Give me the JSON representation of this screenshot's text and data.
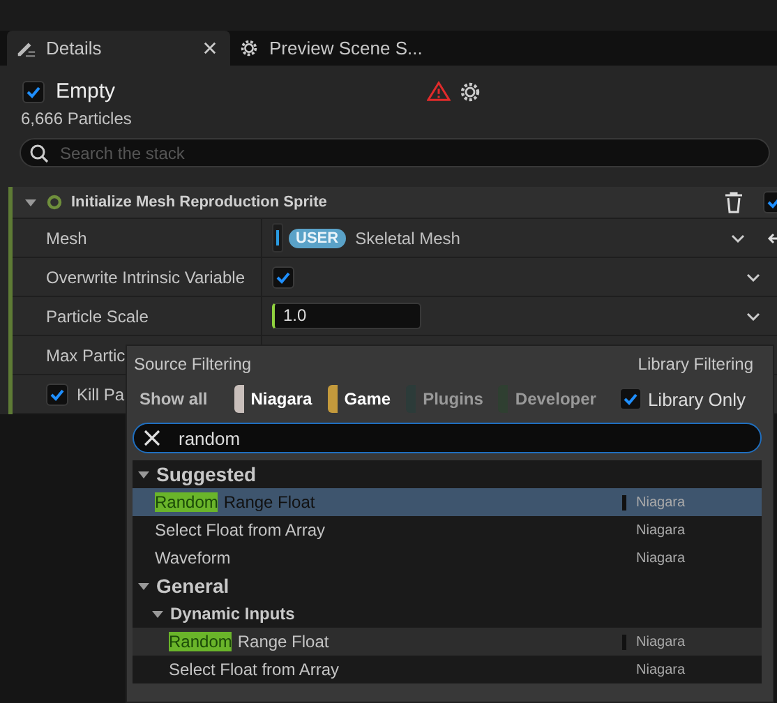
{
  "tabs": [
    {
      "label": "Details",
      "selected": true,
      "closable": true
    },
    {
      "label": "Preview Scene S...",
      "selected": false,
      "closable": false
    }
  ],
  "emitter": {
    "name": "Empty",
    "enabled": true,
    "warning": true,
    "particles": "6,666 Particles"
  },
  "stack_search": {
    "placeholder": "Search the stack"
  },
  "module": {
    "title": "Initialize Mesh Reproduction Sprite",
    "expanded": true,
    "enabled": true,
    "params": [
      {
        "kind": "binding",
        "label": "Mesh",
        "badge": "USER",
        "value": "Skeletal Mesh"
      },
      {
        "kind": "checkbox",
        "label": "Overwrite Intrinsic Variable",
        "checked": true
      },
      {
        "kind": "number",
        "label": "Particle Scale",
        "value": "1.0"
      },
      {
        "kind": "plain",
        "label": "Max Partic"
      },
      {
        "kind": "inline_check",
        "label": "Kill Pa",
        "checked": true
      }
    ]
  },
  "popup": {
    "source_filtering": "Source Filtering",
    "library_filtering": "Library Filtering",
    "show_all": "Show all",
    "sources": [
      {
        "label": "Niagara",
        "color": "#c9bfbb",
        "on": true
      },
      {
        "label": "Game",
        "color": "#c49a3c",
        "on": true
      },
      {
        "label": "Plugins",
        "color": "#2c3b39",
        "on": false
      },
      {
        "label": "Developer",
        "color": "#2f3f31",
        "on": false
      }
    ],
    "library_only": {
      "label": "Library Only",
      "checked": true
    },
    "search": {
      "value": "random"
    },
    "tree": [
      {
        "label": "Suggested",
        "expanded": true,
        "children": [
          {
            "match": "Random",
            "rest": "Range Float",
            "source": "Niagara",
            "selected": true,
            "hovered": false
          },
          {
            "rest": "Select Float from Array",
            "source": "Niagara",
            "selected": false,
            "hovered": false
          },
          {
            "rest": "Waveform",
            "source": "Niagara",
            "selected": false,
            "hovered": false
          }
        ]
      },
      {
        "label": "General",
        "expanded": true,
        "children": [
          {
            "label": "Dynamic Inputs",
            "expanded": true,
            "children": [
              {
                "match": "Random",
                "rest": "Range Float",
                "source": "Niagara",
                "selected": false,
                "hovered": true
              },
              {
                "rest": "Select Float from Array",
                "source": "Niagara",
                "selected": false,
                "hovered": false
              }
            ]
          }
        ]
      }
    ]
  }
}
